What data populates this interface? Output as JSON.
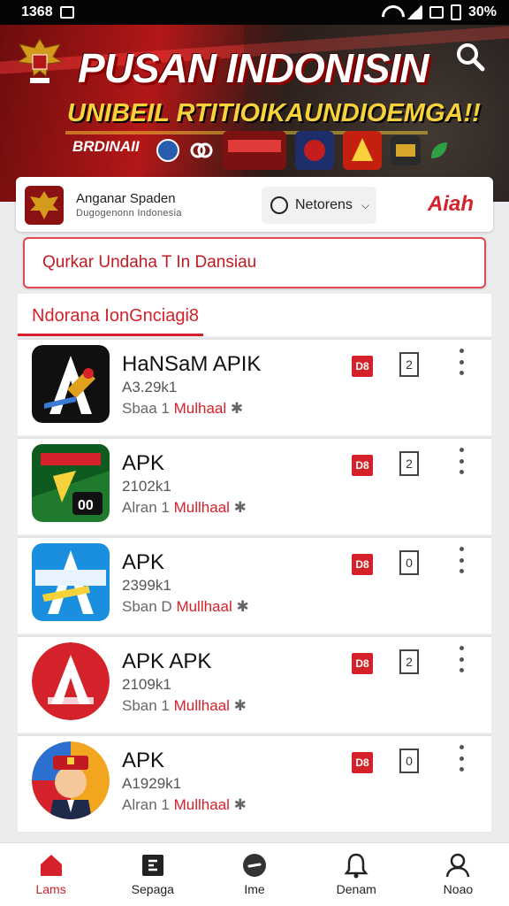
{
  "status_bar": {
    "time": "1368",
    "battery": "30%"
  },
  "banner": {
    "title": "PUSAN INDONISIN",
    "subtitle": "UNIBEIL RTITIOIKAUNDIOEMGA!!",
    "tagline": "BRDINAII"
  },
  "profile": {
    "name": "Anganar Spaden",
    "org": "Dugogenonn Indonesia",
    "network_label": "Netorens",
    "brand": "Aiah"
  },
  "search": {
    "placeholder": "Qurkar Undaha T In Dansiau"
  },
  "tab": {
    "label": "Ndorana IonGnciagi8"
  },
  "apps": [
    {
      "name": "HaNSaM APIK",
      "meta": "A3.29k1",
      "sub_prefix": "Sbaa 1",
      "sub_red": "Mulhaal",
      "badge": "D8",
      "box": "2"
    },
    {
      "name": "APK",
      "meta": "2102k1",
      "sub_prefix": "Alran 1",
      "sub_red": "Mullhaal",
      "badge": "D8",
      "box": "2"
    },
    {
      "name": "APK",
      "meta": "2399k1",
      "sub_prefix": "Sban D",
      "sub_red": "Mullhaal",
      "badge": "D8",
      "box": "0"
    },
    {
      "name": "APK   APK",
      "meta": "2109k1",
      "sub_prefix": "Sban 1",
      "sub_red": "Mullhaal",
      "badge": "D8",
      "box": "2"
    },
    {
      "name": "APK",
      "meta": "A1929k1",
      "sub_prefix": "Alran 1",
      "sub_red": "Mullhaal",
      "badge": "D8",
      "box": "0"
    }
  ],
  "bottom_nav": [
    {
      "label": "Lams",
      "icon": "home-icon"
    },
    {
      "label": "Sepaga",
      "icon": "apps-icon"
    },
    {
      "label": "Ime",
      "icon": "profile-circle-icon"
    },
    {
      "label": "Denam",
      "icon": "bell-icon"
    },
    {
      "label": "Noao",
      "icon": "user-icon"
    }
  ],
  "colors": {
    "accent": "#d4212a",
    "banner_red": "#b31717",
    "banner_gold": "#f7d23a"
  }
}
